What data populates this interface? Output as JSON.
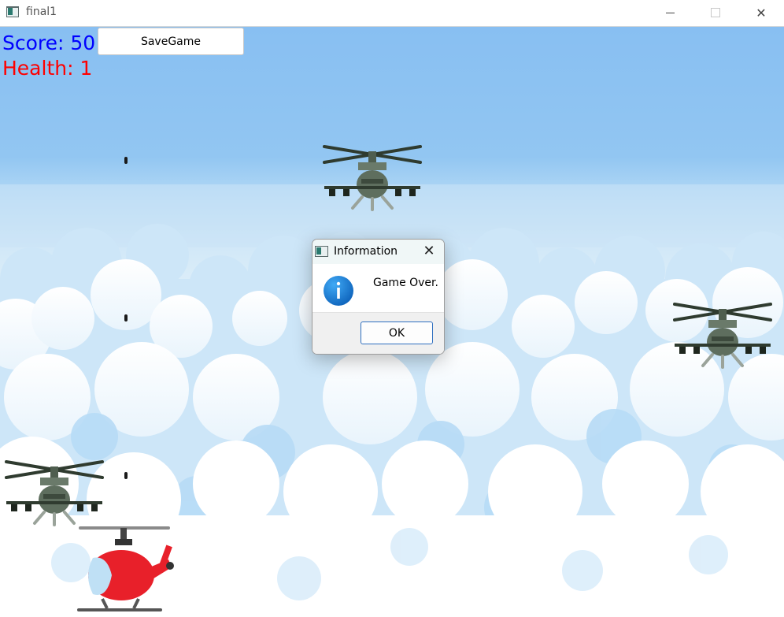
{
  "window": {
    "title": "final1",
    "minimize_icon": "minimize-icon",
    "maximize_icon": "maximize-icon",
    "close_icon": "close-icon",
    "close_glyph": "✕"
  },
  "hud": {
    "score_text": "Score: 50",
    "health_text": "Health: 1",
    "score_color": "#0000ff",
    "health_color": "#ff0000"
  },
  "toolbar": {
    "save_label": "SaveGame"
  },
  "game": {
    "sky_color": "#88bff2",
    "cloud_color": "#ffffff",
    "player_color": "#e8202a",
    "enemy_color": "#5e6e5e"
  },
  "dialog": {
    "title": "Information",
    "message": "Game Over.",
    "ok_label": "OK",
    "close_glyph": "✕",
    "icon": "info-icon"
  }
}
